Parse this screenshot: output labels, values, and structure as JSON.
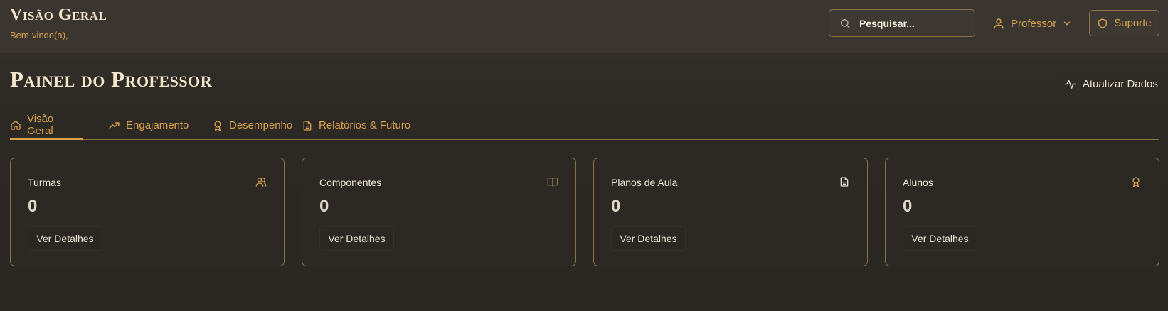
{
  "header": {
    "title": "Visão Geral",
    "welcome": "Bem-vindo(a),",
    "search": {
      "placeholder": "Pesquisar..."
    },
    "user_menu": {
      "label": "Professor",
      "icon": "user-icon"
    },
    "support": {
      "label": "Suporte",
      "icon": "shield-icon"
    }
  },
  "main": {
    "title": "Painel do Professor",
    "refresh_label": "Atualizar Dados",
    "tabs": [
      {
        "label": "Visão Geral",
        "icon": "home-icon",
        "active": true
      },
      {
        "label": "Engajamento",
        "icon": "trending-up-icon",
        "active": false
      },
      {
        "label": "Desempenho",
        "icon": "award-icon",
        "active": false
      },
      {
        "label": "Relatórios & Futuro",
        "icon": "file-text-icon",
        "active": false
      }
    ],
    "cards": [
      {
        "label": "Turmas",
        "value": "0",
        "button": "Ver Detalhes",
        "icon": "users-icon"
      },
      {
        "label": "Componentes",
        "value": "0",
        "button": "Ver Detalhes",
        "icon": "book-open-icon"
      },
      {
        "label": "Planos de Aula",
        "value": "0",
        "button": "Ver Detalhes",
        "icon": "file-text-icon"
      },
      {
        "label": "Alunos",
        "value": "0",
        "button": "Ver Detalhes",
        "icon": "award-icon"
      }
    ]
  },
  "colors": {
    "accent": "#d9a24e",
    "border": "#8a7446",
    "background": "#2c2924",
    "heading": "#f3e6cc"
  }
}
